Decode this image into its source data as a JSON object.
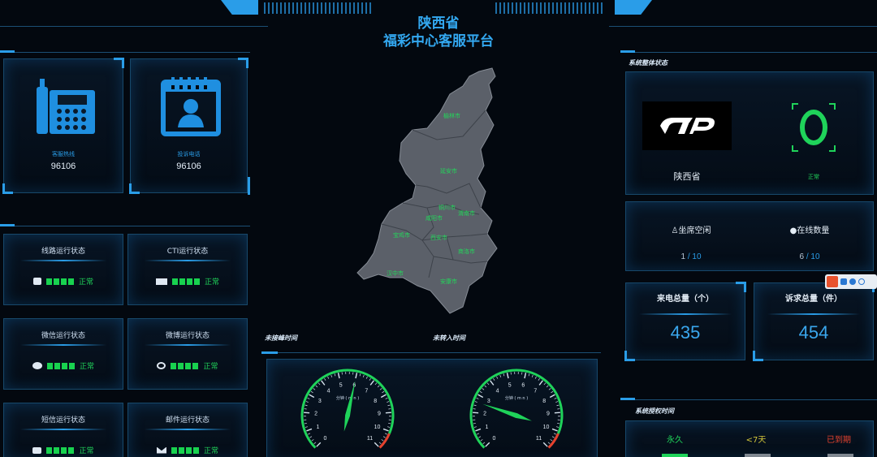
{
  "header": {
    "title_line1": "陕西省",
    "title_line2": "福彩中心客服平台"
  },
  "left": {
    "hotline": {
      "label": "客服热线",
      "value": "96106"
    },
    "feedback": {
      "label": "投诉电话",
      "value": "96106"
    },
    "statuses": [
      {
        "title": "线路运行状态",
        "icon": "phone-icon",
        "status": "正常"
      },
      {
        "title": "CTI运行状态",
        "icon": "cti-icon",
        "status": "正常"
      },
      {
        "title": "微信运行状态",
        "icon": "wechat-icon",
        "status": "正常"
      },
      {
        "title": "微博运行状态",
        "icon": "weibo-icon",
        "status": "正常"
      },
      {
        "title": "短信运行状态",
        "icon": "sms-icon",
        "status": "正常"
      },
      {
        "title": "邮件运行状态",
        "icon": "mail-icon",
        "status": "正常"
      }
    ]
  },
  "map": {
    "cities": [
      "榆林市",
      "延安市",
      "铜川市",
      "渭南市",
      "咸阳市",
      "宝鸡市",
      "西安市",
      "商洛市",
      "汉中市",
      "安康市"
    ]
  },
  "gauges": {
    "label_left": "未接峰时间",
    "label_right": "未转入时间",
    "left": {
      "caption": "分钟 ( m n )",
      "ticks": [
        "0",
        "1",
        "2",
        "3",
        "4",
        "5",
        "6",
        "7",
        "8",
        "9",
        "10",
        "11"
      ],
      "value": 6
    },
    "right": {
      "caption": "分钟 ( m n )",
      "ticks": [
        "0",
        "1",
        "2",
        "3",
        "4",
        "5",
        "6",
        "7",
        "8",
        "9",
        "10",
        "11"
      ],
      "value": 2.6
    }
  },
  "right": {
    "system_status_label": "系统整体状态",
    "province_name": "陕西省",
    "normal_label": "正常",
    "seat_label": "坐席空闲",
    "seat_used": "1",
    "seat_total": "10",
    "online_label": "在线数量",
    "online_used": "6",
    "online_total": "10",
    "calls_label": "来电总量（个）",
    "calls_value": "435",
    "complaints_label": "诉求总量（件）",
    "complaints_value": "454",
    "license_label": "系统授权时间",
    "license_forever": "永久",
    "license_week": "<7天",
    "license_expired": "已到期"
  },
  "colors": {
    "accent": "#2a9de8",
    "normal_green": "#18d24f",
    "map_fill": "#5b6069",
    "expired_red": "#e5422e",
    "warn_yellow": "#d2c63a"
  }
}
